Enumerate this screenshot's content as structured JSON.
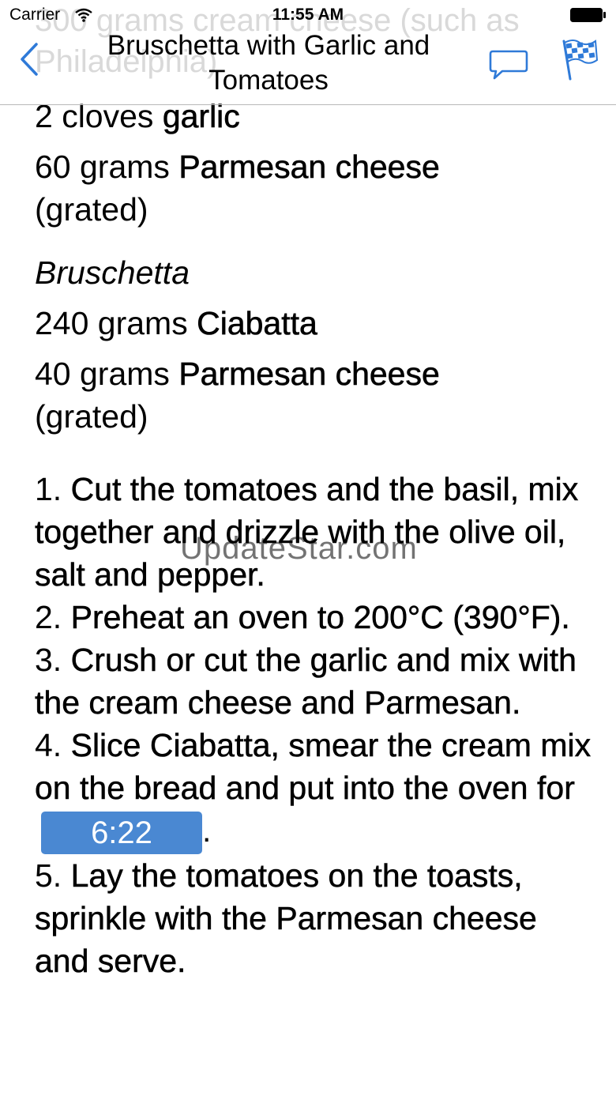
{
  "status": {
    "carrier": "Carrier",
    "time": "11:55 AM"
  },
  "header": {
    "ghost_line_1": "300 grams cream cheese (such as",
    "ghost_line_2": "Philadelphia)",
    "title": "Bruschetta with Garlic and Tomatoes"
  },
  "ingredients_top": [
    {
      "amount": "2 cloves ",
      "name": "garlic",
      "note": ""
    },
    {
      "amount": "60 grams ",
      "name": "Parmesan cheese",
      "note": "(grated)"
    }
  ],
  "section": {
    "title": "Bruschetta"
  },
  "ingredients_bruschetta": [
    {
      "amount": "240 grams ",
      "name": "Ciabatta",
      "note": ""
    },
    {
      "amount": "40 grams ",
      "name": "Parmesan cheese",
      "note": "(grated)"
    }
  ],
  "steps": [
    {
      "num": "1. ",
      "text": "Cut the tomatoes and the basil, mix together and drizzle with the olive oil, salt and pepper."
    },
    {
      "num": "2. ",
      "text": "Preheat an oven to 200°C (390°F)."
    },
    {
      "num": "3. ",
      "text": "Crush or cut the garlic and mix with the cream cheese and Parmesan."
    },
    {
      "num": "4. ",
      "text": "Slice Ciabatta, smear the cream mix on the bread and put into the oven for",
      "timer": "6:22",
      "after": "."
    },
    {
      "num": "5. ",
      "text": "Lay the tomatoes on the toasts, sprinkle with the Parmesan cheese and serve."
    }
  ],
  "watermark": "UpdateStar.com",
  "colors": {
    "accent": "#2f7ad8",
    "timer_bg": "#4a88d2",
    "ghost_text": "#d9d9d9"
  },
  "icons": {
    "back": "chevron-left-icon",
    "comment": "speech-bubble-icon",
    "flag": "checkered-flag-icon"
  }
}
